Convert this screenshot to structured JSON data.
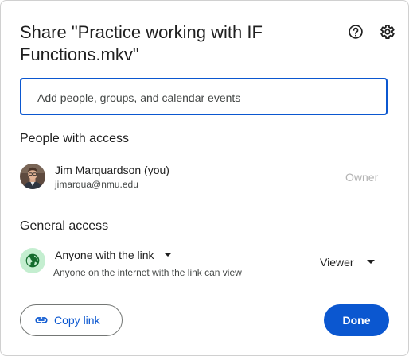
{
  "dialog": {
    "title": "Share \"Practice working with IF Functions.mkv\"",
    "help_icon": "help-circle-icon",
    "settings_icon": "gear-icon"
  },
  "add_people": {
    "placeholder": "Add people, groups, and calendar events",
    "value": ""
  },
  "people_with_access": {
    "heading": "People with access",
    "people": [
      {
        "name": "Jim Marquardson (you)",
        "email": "jimarqua@nmu.edu",
        "role": "Owner",
        "avatar_icon": "user-avatar"
      }
    ]
  },
  "general_access": {
    "heading": "General access",
    "access_level": "Anyone with the link",
    "description": "Anyone on the internet with the link can view",
    "role": "Viewer",
    "icon": "globe-icon"
  },
  "footer": {
    "copy_link_label": "Copy link",
    "copy_link_icon": "link-icon",
    "done_label": "Done"
  },
  "colors": {
    "accent": "#0b57d0",
    "globe_bg": "#c4eed0",
    "globe_fg": "#146c2e",
    "muted": "#b3b3b3"
  }
}
